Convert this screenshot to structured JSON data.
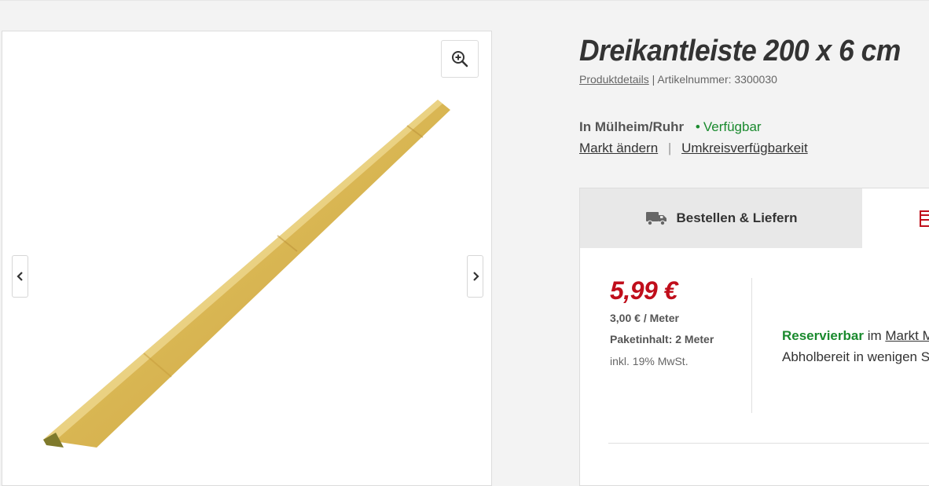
{
  "product": {
    "title": "Dreikantleiste 200 x 6 cm",
    "details_link": "Produktdetails",
    "article_label": "Artikelnummer: 3300030"
  },
  "gallery": {
    "zoom_icon": "zoom-in-icon",
    "prev_icon": "chevron-left-icon",
    "next_icon": "chevron-right-icon"
  },
  "store": {
    "name": "In Mülheim/Ruhr",
    "availability": "Verfügbar",
    "change_link": "Markt ändern",
    "separator": "|",
    "nearby_link": "Umkreisverfügbarkeit"
  },
  "tabs": {
    "deliver_label": "Bestellen & Liefern",
    "deliver_icon": "truck-icon",
    "pickup_icon": "store-icon"
  },
  "pricing": {
    "price": "5,99 €",
    "unit_price": "3,00 € / Meter",
    "package": "Paketinhalt: 2 Meter",
    "vat": "inkl. 19% MwSt."
  },
  "pickup": {
    "reservable": "Reservierbar",
    "in_text": " im ",
    "market_link": "Markt M",
    "ready": "Abholbereit in wenigen S"
  },
  "colors": {
    "accent_red": "#c00e1b",
    "available_green": "#1a8a2e"
  }
}
